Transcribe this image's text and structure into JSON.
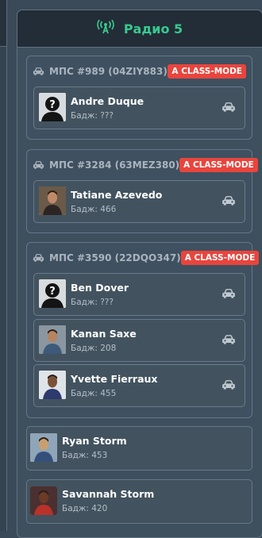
{
  "panel": {
    "title": "Радио 5",
    "icon": "radio-tower-icon"
  },
  "units": [
    {
      "name": "МПС #989 (04ZIY883)",
      "badge": "A CLASS-MODE",
      "members": [
        {
          "name": "Andre Duque",
          "badge": "Бадж: ???",
          "avatar": "silhouette"
        }
      ]
    },
    {
      "name": "МПС #3284 (63MEZ380)",
      "badge": "A CLASS-MODE",
      "members": [
        {
          "name": "Tatiane Azevedo",
          "badge": "Бадж: 466",
          "avatar": "photo"
        }
      ]
    },
    {
      "name": "МПС #3590 (22DQO347)",
      "badge": "A CLASS-MODE",
      "members": [
        {
          "name": "Ben Dover",
          "badge": "Бадж: ???",
          "avatar": "silhouette"
        },
        {
          "name": "Kanan Saxe",
          "badge": "Бадж: 208",
          "avatar": "photo"
        },
        {
          "name": "Yvette Fierraux",
          "badge": "Бадж: 455",
          "avatar": "photo"
        }
      ]
    }
  ],
  "solo_members": [
    {
      "name": "Ryan Storm",
      "badge": "Бадж: 453",
      "avatar": "photo"
    },
    {
      "name": "Savannah Storm",
      "badge": "Бадж: 420",
      "avatar": "photo"
    }
  ],
  "colors": {
    "accent": "#38c98f",
    "badge": "#e8453d",
    "panel": "#3e4f5e",
    "header": "#232d37"
  }
}
